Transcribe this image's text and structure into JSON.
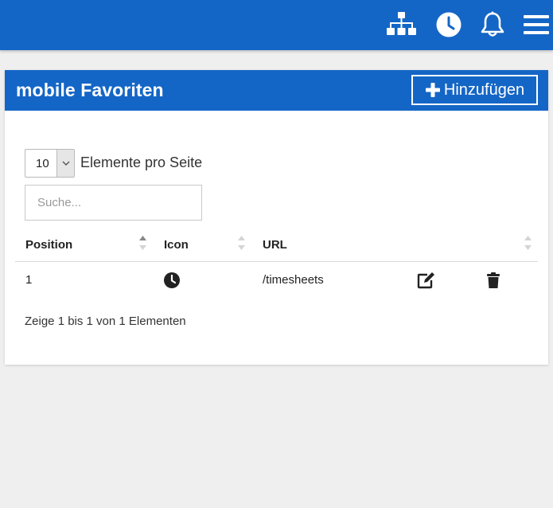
{
  "topbar": {
    "icons": [
      "sitemap-icon",
      "clock-icon",
      "bell-icon",
      "menu-icon"
    ],
    "color": "#1466c6"
  },
  "card": {
    "title": "mobile Favoriten",
    "add_button_label": "Hinzufügen"
  },
  "table_controls": {
    "page_length": "10",
    "page_length_label": "Elemente pro Seite",
    "search_placeholder": "Suche..."
  },
  "table": {
    "columns": [
      "Position",
      "Icon",
      "URL"
    ],
    "rows": [
      {
        "position": "1",
        "icon": "clock-icon",
        "url": "/timesheets",
        "actions": [
          "edit-icon",
          "trash-icon"
        ]
      }
    ],
    "info": "Zeige 1 bis 1 von 1 Elementen"
  }
}
